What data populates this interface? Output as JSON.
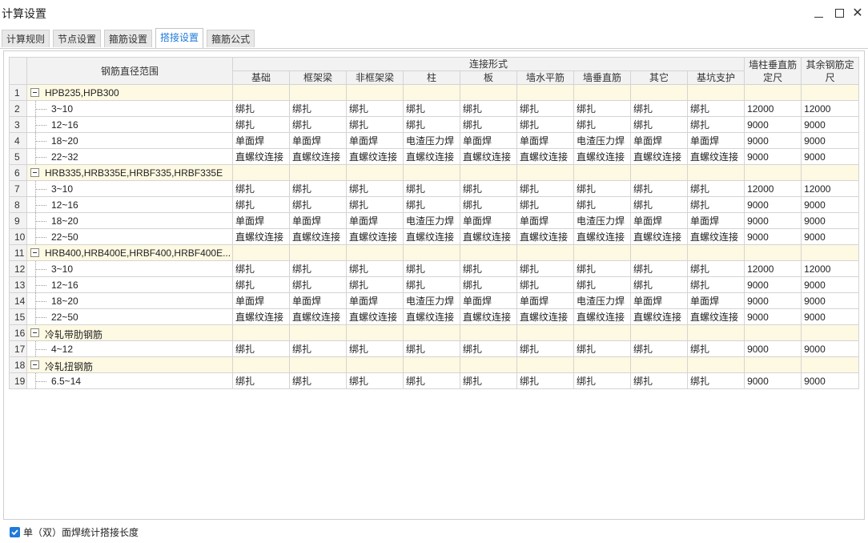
{
  "window": {
    "title": "计算设置"
  },
  "tabs": [
    {
      "label": "计算规则"
    },
    {
      "label": "节点设置"
    },
    {
      "label": "箍筋设置"
    },
    {
      "label": "搭接设置"
    },
    {
      "label": "箍筋公式"
    }
  ],
  "table": {
    "header": {
      "range": "钢筋直径范围",
      "connection": "连接形式",
      "columns": [
        "基础",
        "框架梁",
        "非框架梁",
        "柱",
        "板",
        "墙水平筋",
        "墙垂直筋",
        "其它",
        "基坑支护"
      ],
      "wall_length": "墙柱垂直筋定尺",
      "other_length": "其余钢筋定尺"
    },
    "rows": [
      {
        "n": "1",
        "group": true,
        "range": "HPB235,HPB300"
      },
      {
        "n": "2",
        "range": "3~10",
        "c": [
          "绑扎",
          "绑扎",
          "绑扎",
          "绑扎",
          "绑扎",
          "绑扎",
          "绑扎",
          "绑扎",
          "绑扎"
        ],
        "w": "12000",
        "o": "12000"
      },
      {
        "n": "3",
        "range": "12~16",
        "c": [
          "绑扎",
          "绑扎",
          "绑扎",
          "绑扎",
          "绑扎",
          "绑扎",
          "绑扎",
          "绑扎",
          "绑扎"
        ],
        "w": "9000",
        "o": "9000"
      },
      {
        "n": "4",
        "range": "18~20",
        "c": [
          "单面焊",
          "单面焊",
          "单面焊",
          "电渣压力焊",
          "单面焊",
          "单面焊",
          "电渣压力焊",
          "单面焊",
          "单面焊"
        ],
        "w": "9000",
        "o": "9000"
      },
      {
        "n": "5",
        "range": "22~32",
        "c": [
          "直螺纹连接",
          "直螺纹连接",
          "直螺纹连接",
          "直螺纹连接",
          "直螺纹连接",
          "直螺纹连接",
          "直螺纹连接",
          "直螺纹连接",
          "直螺纹连接"
        ],
        "w": "9000",
        "o": "9000"
      },
      {
        "n": "6",
        "group": true,
        "range": "HRB335,HRB335E,HRBF335,HRBF335E"
      },
      {
        "n": "7",
        "range": "3~10",
        "c": [
          "绑扎",
          "绑扎",
          "绑扎",
          "绑扎",
          "绑扎",
          "绑扎",
          "绑扎",
          "绑扎",
          "绑扎"
        ],
        "w": "12000",
        "o": "12000"
      },
      {
        "n": "8",
        "range": "12~16",
        "c": [
          "绑扎",
          "绑扎",
          "绑扎",
          "绑扎",
          "绑扎",
          "绑扎",
          "绑扎",
          "绑扎",
          "绑扎"
        ],
        "w": "9000",
        "o": "9000"
      },
      {
        "n": "9",
        "range": "18~20",
        "c": [
          "单面焊",
          "单面焊",
          "单面焊",
          "电渣压力焊",
          "单面焊",
          "单面焊",
          "电渣压力焊",
          "单面焊",
          "单面焊"
        ],
        "w": "9000",
        "o": "9000"
      },
      {
        "n": "10",
        "range": "22~50",
        "c": [
          "直螺纹连接",
          "直螺纹连接",
          "直螺纹连接",
          "直螺纹连接",
          "直螺纹连接",
          "直螺纹连接",
          "直螺纹连接",
          "直螺纹连接",
          "直螺纹连接"
        ],
        "w": "9000",
        "o": "9000"
      },
      {
        "n": "11",
        "group": true,
        "range": "HRB400,HRB400E,HRBF400,HRBF400E..."
      },
      {
        "n": "12",
        "range": "3~10",
        "c": [
          "绑扎",
          "绑扎",
          "绑扎",
          "绑扎",
          "绑扎",
          "绑扎",
          "绑扎",
          "绑扎",
          "绑扎"
        ],
        "w": "12000",
        "o": "12000"
      },
      {
        "n": "13",
        "range": "12~16",
        "c": [
          "绑扎",
          "绑扎",
          "绑扎",
          "绑扎",
          "绑扎",
          "绑扎",
          "绑扎",
          "绑扎",
          "绑扎"
        ],
        "w": "9000",
        "o": "9000"
      },
      {
        "n": "14",
        "range": "18~20",
        "c": [
          "单面焊",
          "单面焊",
          "单面焊",
          "电渣压力焊",
          "单面焊",
          "单面焊",
          "电渣压力焊",
          "单面焊",
          "单面焊"
        ],
        "w": "9000",
        "o": "9000"
      },
      {
        "n": "15",
        "range": "22~50",
        "c": [
          "直螺纹连接",
          "直螺纹连接",
          "直螺纹连接",
          "直螺纹连接",
          "直螺纹连接",
          "直螺纹连接",
          "直螺纹连接",
          "直螺纹连接",
          "直螺纹连接"
        ],
        "w": "9000",
        "o": "9000"
      },
      {
        "n": "16",
        "group": true,
        "range": "冷轧带肋钢筋"
      },
      {
        "n": "17",
        "range": "4~12",
        "c": [
          "绑扎",
          "绑扎",
          "绑扎",
          "绑扎",
          "绑扎",
          "绑扎",
          "绑扎",
          "绑扎",
          "绑扎"
        ],
        "w": "9000",
        "o": "9000"
      },
      {
        "n": "18",
        "group": true,
        "range": "冷轧扭钢筋"
      },
      {
        "n": "19",
        "range": "6.5~14",
        "c": [
          "绑扎",
          "绑扎",
          "绑扎",
          "绑扎",
          "绑扎",
          "绑扎",
          "绑扎",
          "绑扎",
          "绑扎"
        ],
        "w": "9000",
        "o": "9000"
      }
    ]
  },
  "footer": {
    "checkbox_label": "单（双）面焊统计搭接长度",
    "checked": true
  },
  "colors": {
    "accent": "#1f7ad9",
    "group_row": "#fdf9e2"
  }
}
